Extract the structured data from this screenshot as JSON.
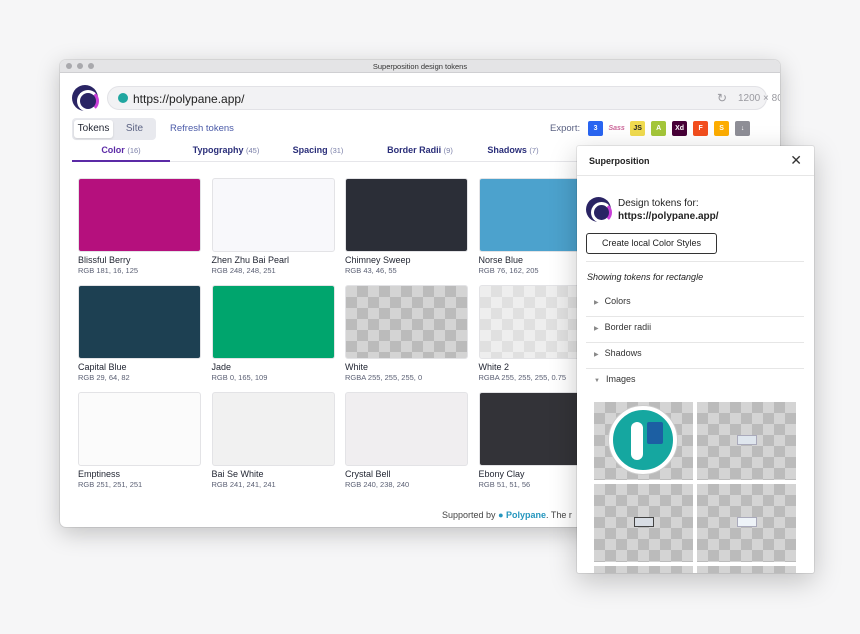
{
  "window": {
    "title": "Superposition design tokens"
  },
  "urlbar": {
    "url": "https://polypane.app/",
    "viewport": "1200 × 800",
    "help": "?"
  },
  "toggle": {
    "tokens": "Tokens",
    "site": "Site"
  },
  "refresh_label": "Refresh tokens",
  "export": {
    "label": "Export:",
    "icons": [
      {
        "name": "css-icon",
        "color": "#2965f1",
        "glyph": "3"
      },
      {
        "name": "sass-icon",
        "color": "#cc6699",
        "glyph": "Sass"
      },
      {
        "name": "javascript-icon",
        "color": "#f0db4f",
        "glyph": "JS"
      },
      {
        "name": "android-icon",
        "color": "#a4c639",
        "glyph": "A"
      },
      {
        "name": "adobe-xd-icon",
        "color": "#470137",
        "glyph": "Xd"
      },
      {
        "name": "figma-icon",
        "color": "#f24e1e",
        "glyph": "F"
      },
      {
        "name": "sketch-icon",
        "color": "#fdad00",
        "glyph": "S"
      },
      {
        "name": "download-icon",
        "color": "#8e8e96",
        "glyph": "↓"
      }
    ]
  },
  "tabs": [
    {
      "label": "Color",
      "count": "(16)"
    },
    {
      "label": "Typography",
      "count": "(45)"
    },
    {
      "label": "Spacing",
      "count": "(31)"
    },
    {
      "label": "Border Radii",
      "count": "(9)"
    },
    {
      "label": "Shadows",
      "count": "(7)"
    }
  ],
  "colors": [
    {
      "name": "Blissful Berry",
      "value": "RGB 181, 16, 125",
      "hex": "#b5107d"
    },
    {
      "name": "Zhen Zhu Bai Pearl",
      "value": "RGB 248, 248, 251",
      "hex": "#f8f8fb"
    },
    {
      "name": "Chimney Sweep",
      "value": "RGB 43, 46, 55",
      "hex": "#2b2e37"
    },
    {
      "name": "Norse Blue",
      "value": "RGB 76, 162, 205",
      "hex": "#4ca2cd"
    },
    {
      "name": "Capital Blue",
      "value": "RGB 29, 64, 82",
      "hex": "#1d4052"
    },
    {
      "name": "Jade",
      "value": "RGB 0, 165, 109",
      "hex": "#00a56d"
    },
    {
      "name": "White",
      "value": "RGBA 255, 255, 255, 0",
      "hex": "transparent"
    },
    {
      "name": "White 2",
      "value": "RGBA 255, 255, 255, 0.75",
      "hex": "transparent-light"
    },
    {
      "name": "Emptiness",
      "value": "RGB 251, 251, 251",
      "hex": "#fbfbfb"
    },
    {
      "name": "Bai Se White",
      "value": "RGB 241, 241, 241",
      "hex": "#f1f1f1"
    },
    {
      "name": "Crystal Bell",
      "value": "RGB 240, 238, 240",
      "hex": "#f0eef0"
    },
    {
      "name": "Ebony Clay",
      "value": "RGB 51, 51, 56",
      "hex": "#333338"
    }
  ],
  "footer": {
    "prefix": "Supported by",
    "brand": "Polypane",
    "suffix": ". The r"
  },
  "panel": {
    "title": "Superposition",
    "close": "✕",
    "design_tokens_for": "Design tokens for:",
    "site": "https://polypane.app/",
    "button": "Create local Color Styles",
    "showing": "Showing tokens for rectangle",
    "sections": [
      {
        "label": "Colors",
        "expanded": false
      },
      {
        "label": "Border radii",
        "expanded": false
      },
      {
        "label": "Shadows",
        "expanded": false
      },
      {
        "label": "Images",
        "expanded": true
      }
    ]
  }
}
